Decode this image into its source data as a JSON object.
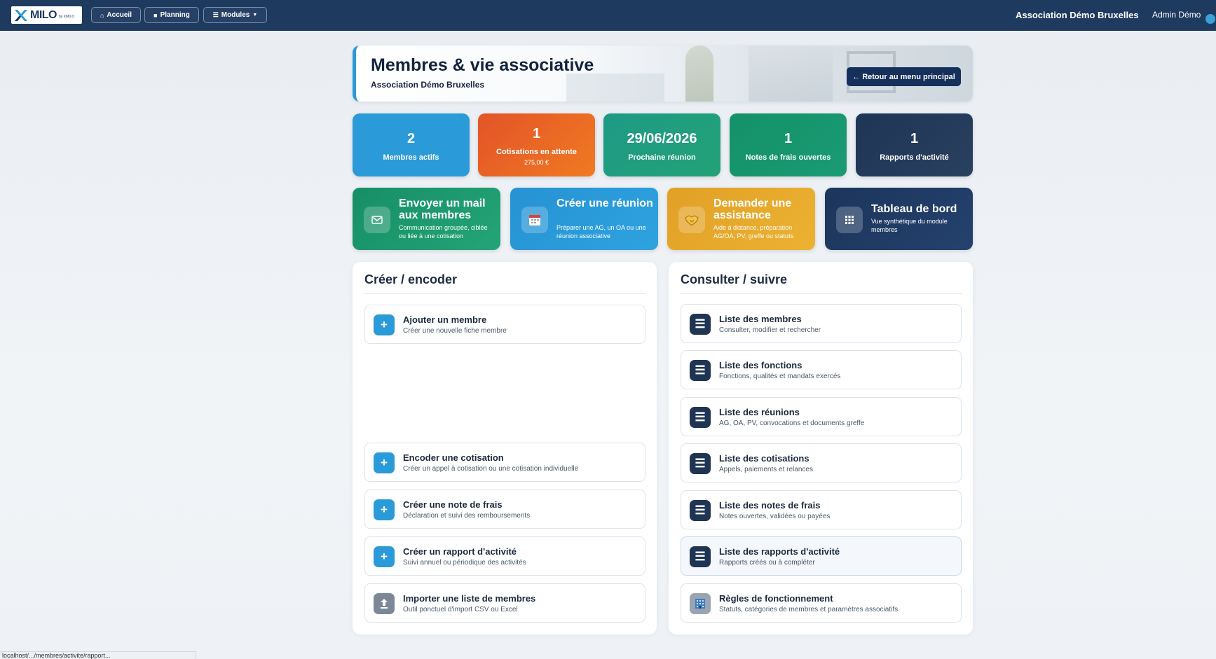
{
  "navbar": {
    "logo_text": "MILO",
    "logo_sub": "by XMILO",
    "home_label": "Accueil",
    "planning_label": "Planning",
    "modules_label": "Modules",
    "org_name": "Association Démo Bruxelles",
    "user_name": "Admin Démo"
  },
  "hero": {
    "title": "Membres & vie associative",
    "subtitle": "Association Démo Bruxelles",
    "back_label": "← Retour au menu principal"
  },
  "stats": [
    {
      "value": "2",
      "label": "Membres actifs",
      "sub": "",
      "color": "#2a9ad8"
    },
    {
      "value": "1",
      "label": "Cotisations en attente",
      "sub": "275,00 €",
      "color": "#e8622a"
    },
    {
      "value": "29/06/2026",
      "label": "Prochaine réunion",
      "sub": "",
      "color": "#1f9d7f"
    },
    {
      "value": "1",
      "label": "Notes de frais ouvertes",
      "sub": "",
      "color": "#17936f"
    },
    {
      "value": "1",
      "label": "Rapports d'activité",
      "sub": "",
      "color": "#243a5b"
    }
  ],
  "actions": [
    {
      "title": "Envoyer un mail aux membres",
      "desc": "Communication groupée, ciblée ou liée à une cotisation",
      "color": "#1e9a6c",
      "icon": "mail-icon"
    },
    {
      "title": "Créer une réunion",
      "desc": "Préparer une AG, un OA ou une réunion associative",
      "color": "#2a9ad8",
      "icon": "calendar-icon"
    },
    {
      "title": "Demander une assistance",
      "desc": "Aide à distance, préparation AG/OA, PV, greffe ou statuts",
      "color": "#e4a82a",
      "icon": "handshake-icon"
    },
    {
      "title": "Tableau de bord",
      "desc": "Vue synthétique du module membres",
      "color": "#1f3a63",
      "icon": "grid-icon"
    }
  ],
  "left_panel": {
    "title": "Créer / encoder",
    "items": [
      {
        "name": "Ajouter un membre",
        "desc": "Créer une nouvelle fiche membre",
        "icon": "plus-icon"
      },
      {
        "name": "Encoder une cotisation",
        "desc": "Créer un appel à cotisation ou une cotisation individuelle",
        "icon": "plus-icon"
      },
      {
        "name": "Créer une note de frais",
        "desc": "Déclaration et suivi des remboursements",
        "icon": "plus-icon"
      },
      {
        "name": "Créer un rapport d'activité",
        "desc": "Suivi annuel ou périodique des activités",
        "icon": "plus-icon"
      },
      {
        "name": "Importer une liste de membres",
        "desc": "Outil ponctuel d'import CSV ou Excel",
        "icon": "upload-icon"
      }
    ]
  },
  "right_panel": {
    "title": "Consulter / suivre",
    "items": [
      {
        "name": "Liste des membres",
        "desc": "Consulter, modifier et rechercher",
        "icon": "list-icon"
      },
      {
        "name": "Liste des fonctions",
        "desc": "Fonctions, qualités et mandats exercés",
        "icon": "list-icon"
      },
      {
        "name": "Liste des réunions",
        "desc": "AG, OA, PV, convocations et documents greffe",
        "icon": "list-icon"
      },
      {
        "name": "Liste des cotisations",
        "desc": "Appels, paiements et relances",
        "icon": "list-icon"
      },
      {
        "name": "Liste des notes de frais",
        "desc": "Notes ouvertes, validées ou payées",
        "icon": "list-icon"
      },
      {
        "name": "Liste des rapports d'activité",
        "desc": "Rapports créés ou à compléter",
        "icon": "list-icon"
      },
      {
        "name": "Règles de fonctionnement",
        "desc": "Statuts, catégories de membres et paramètres associatifs",
        "icon": "building-icon"
      }
    ]
  },
  "statusbar": {
    "text": "localhost/.../membres/activite/rapport..."
  }
}
